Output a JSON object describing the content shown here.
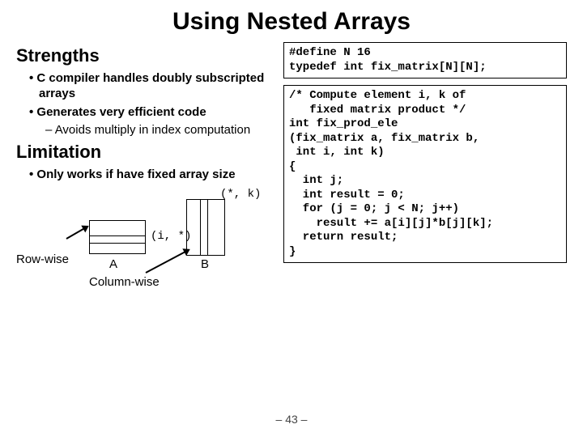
{
  "title": "Using Nested Arrays",
  "left": {
    "strengths_head": "Strengths",
    "s1": "C compiler handles doubly subscripted arrays",
    "s2": "Generates very efficient code",
    "s2a": "Avoids multiply in index computation",
    "limit_head": "Limitation",
    "l1": "Only works if have fixed array size"
  },
  "diagram": {
    "istar": "(i, *)",
    "stark": "(*, k)",
    "A": "A",
    "B": "B",
    "rowwise": "Row-wise",
    "colwise": "Column-wise"
  },
  "code1": "#define N 16\ntypedef int fix_matrix[N][N];",
  "code2": "/* Compute element i, k of\n   fixed matrix product */\nint fix_prod_ele\n(fix_matrix a, fix_matrix b,\n int i, int k)\n{\n  int j;\n  int result = 0;\n  for (j = 0; j < N; j++)\n    result += a[i][j]*b[j][k];\n  return result;\n}",
  "pagenum": "– 43 –"
}
